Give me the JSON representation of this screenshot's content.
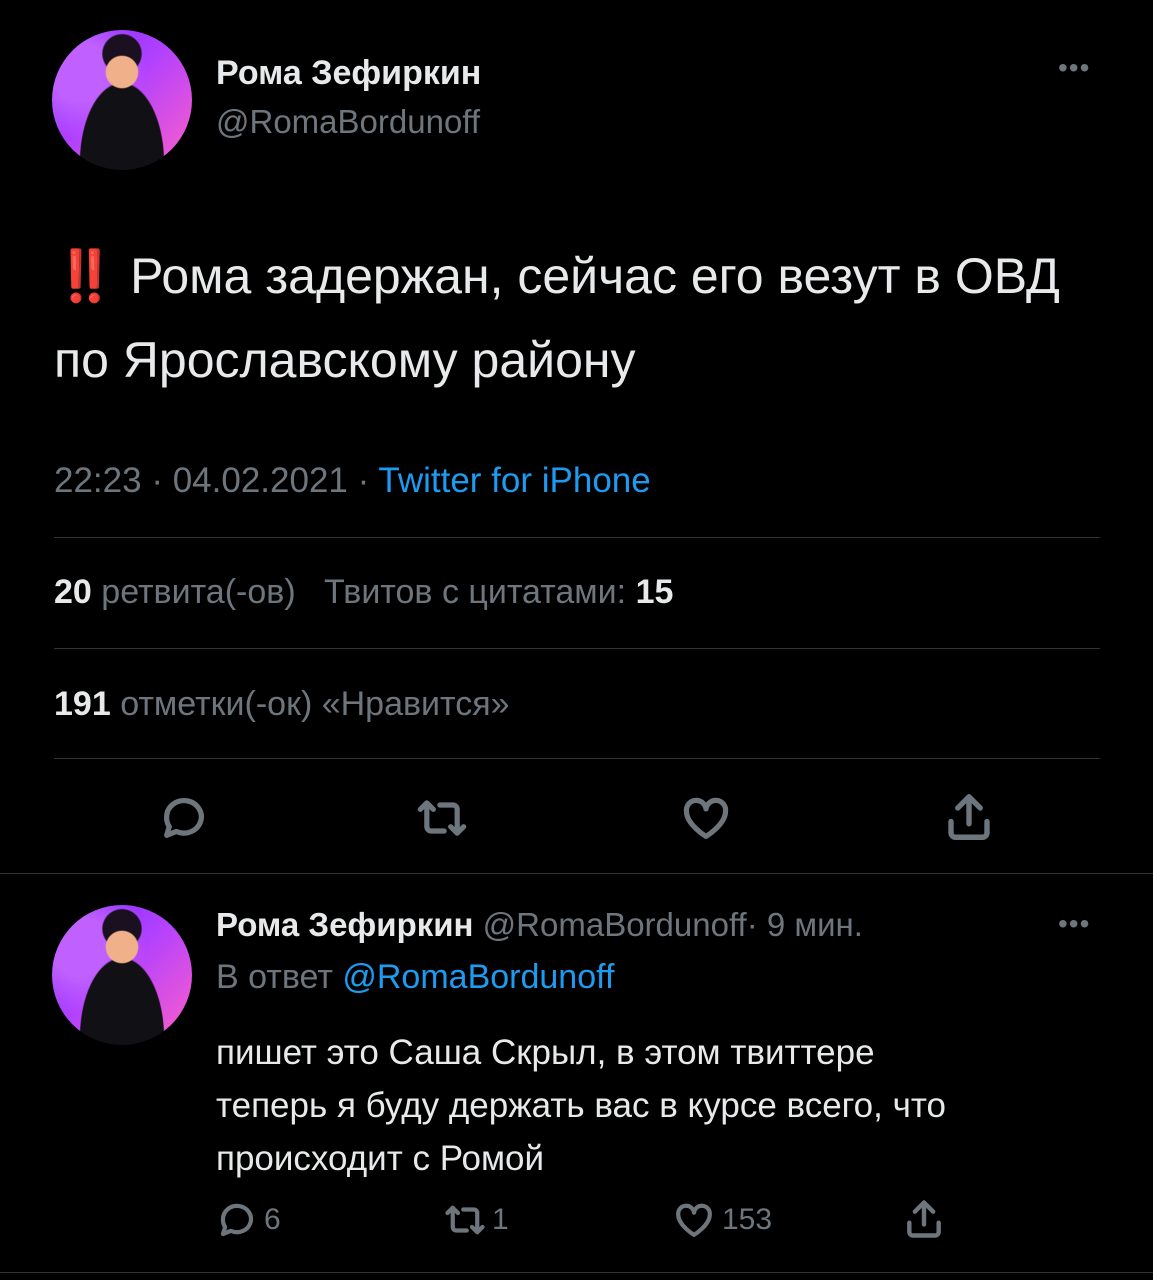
{
  "main_tweet": {
    "author_name": "Рома Зефиркин",
    "author_handle": "@RomaBordunoff",
    "more_icon": "more-dots-icon",
    "emoji": "‼️",
    "text": "Рома задержан, сейчас его везут в ОВД по Ярославскому району",
    "time": "22:23",
    "date": "04.02.2021",
    "separator": "·",
    "source": "Twitter for iPhone",
    "retweets_count": "20",
    "retweets_label": "ретвита(-ов)",
    "quotes_label": "Твитов с цитатами:",
    "quotes_count": "15",
    "likes_count": "191",
    "likes_label": "отметки(-ок) «Нравится»",
    "actions": [
      "reply-icon",
      "retweet-icon",
      "like-icon",
      "share-icon"
    ]
  },
  "reply_tweet": {
    "author_name": "Рома Зефиркин",
    "author_handle": "@RomaBordunoff",
    "separator": "·",
    "time_ago": "9 мин.",
    "reply_prefix": "В ответ",
    "reply_to": "@RomaBordunoff",
    "text_line1": "пишет это Саша Скрыл, в этом твиттере",
    "text_line2": "теперь я буду держать вас в курсе всего, что",
    "text_line3": "происходит с Ромой",
    "reply_count": "6",
    "retweet_count": "1",
    "like_count": "153"
  },
  "colors": {
    "background": "#000000",
    "text": "#e7e9ea",
    "muted": "#6e767d",
    "link": "#1d9bf0",
    "divider": "#2f3336",
    "alert": "#f4212e"
  }
}
